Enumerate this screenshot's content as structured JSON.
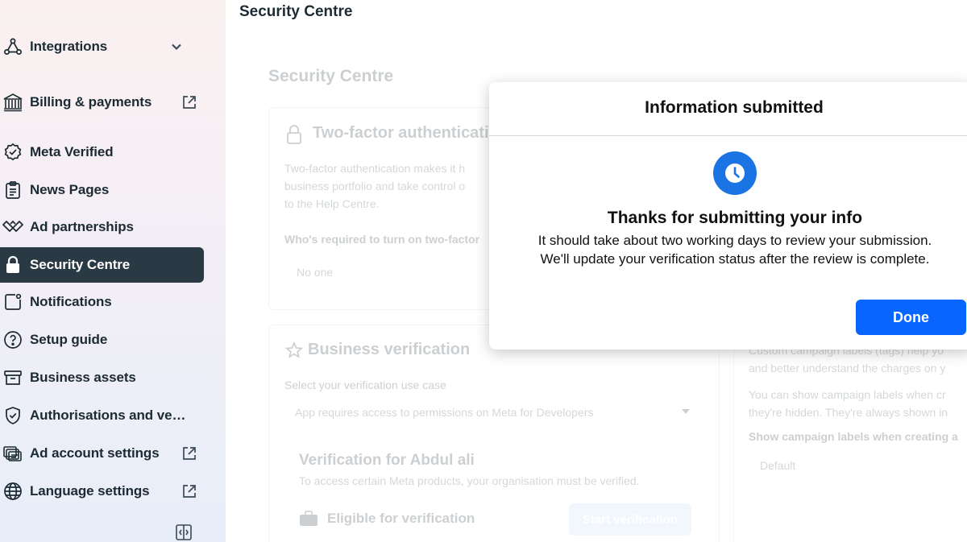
{
  "sidebar": {
    "items": [
      {
        "label": "Integrations",
        "icon": "integrations-icon"
      },
      {
        "label": "Billing & payments",
        "icon": "bank-icon"
      },
      {
        "label": "Meta Verified",
        "icon": "verified-badge-icon"
      },
      {
        "label": "News Pages",
        "icon": "clipboard-icon"
      },
      {
        "label": "Ad partnerships",
        "icon": "handshake-icon"
      },
      {
        "label": "Security Centre",
        "icon": "lock-icon",
        "active": true
      },
      {
        "label": "Notifications",
        "icon": "notification-icon"
      },
      {
        "label": "Setup guide",
        "icon": "question-circle-icon"
      },
      {
        "label": "Business assets",
        "icon": "archive-box-icon"
      },
      {
        "label": "Authorisations and ver…",
        "icon": "shield-check-icon"
      },
      {
        "label": "Ad account settings",
        "icon": "ad-accounts-icon"
      },
      {
        "label": "Language settings",
        "icon": "globe-icon"
      }
    ]
  },
  "main": {
    "page_title": "Security Centre",
    "background": {
      "section_title": "Security Centre",
      "two_factor": {
        "title": "Two-factor authenticatio",
        "desc_lines": [
          "Two-factor authentication makes it h",
          "business portfolio and take control o",
          "to the Help Centre."
        ],
        "required_label": "Who's required to turn on two-factor",
        "required_value": "No one"
      },
      "business_verification": {
        "title": "Business verification",
        "use_case_label": "Select your verification use case",
        "use_case_value": "App requires access to permissions on Meta for Developers",
        "verify_title": "Verification for Abdul ali",
        "verify_desc": "To access certain Meta products, your organisation must be verified.",
        "eligible_label": "Eligible for verification",
        "start_button": "Start verification"
      },
      "campaign_labels": {
        "lines": [
          "Custom campaign labels (tags) help yo",
          "and better understand the charges on y",
          "You can show campaign labels when cr",
          "they're hidden. They're always shown in"
        ],
        "show_label": "Show campaign labels when creating a",
        "show_value": "Default"
      }
    }
  },
  "modal": {
    "title": "Information submitted",
    "heading": "Thanks for submitting your info",
    "body_line1": "It should take about two working days to review your submission.",
    "body_line2": "We'll update your verification status after the review is complete.",
    "done_label": "Done"
  },
  "colors": {
    "active_nav_bg": "#2a3a44",
    "primary_button": "#0866ff",
    "clock_badge": "#1b74e4"
  }
}
